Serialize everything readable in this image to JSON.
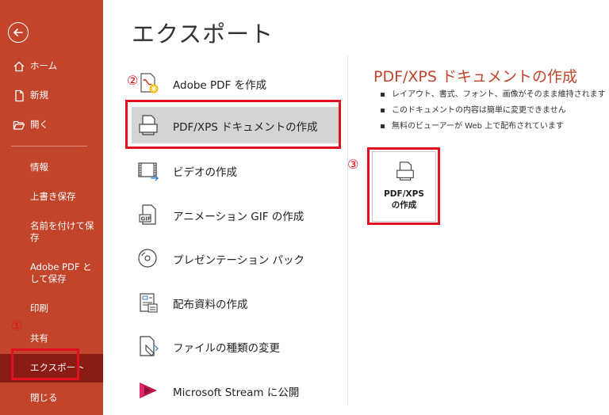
{
  "sidebar": {
    "back_label": "",
    "items": [
      {
        "label": "ホーム",
        "icon": "home-icon"
      },
      {
        "label": "新規",
        "icon": "new-file-icon"
      },
      {
        "label": "開く",
        "icon": "folder-open-icon"
      },
      {
        "label": "情報"
      },
      {
        "label": "上書き保存"
      },
      {
        "label": "名前を付けて保存"
      },
      {
        "label": "Adobe PDF として保存"
      },
      {
        "label": "印刷"
      },
      {
        "label": "共有"
      },
      {
        "label": "エクスポート"
      },
      {
        "label": "閉じる"
      }
    ],
    "active_item": "エクスポート"
  },
  "main": {
    "title": "エクスポート",
    "options": [
      {
        "label": "Adobe PDF を作成",
        "icon": "adobe-pdf-icon"
      },
      {
        "label": "PDF/XPS ドキュメントの作成",
        "icon": "pdf-document-icon"
      },
      {
        "label": "ビデオの作成",
        "icon": "video-icon"
      },
      {
        "label": "アニメーション GIF の作成",
        "icon": "gif-icon"
      },
      {
        "label": "プレゼンテーション パック",
        "icon": "cd-icon"
      },
      {
        "label": "配布資料の作成",
        "icon": "handout-icon"
      },
      {
        "label": "ファイルの種類の変更",
        "icon": "change-type-icon"
      },
      {
        "label": "Microsoft Stream に公開",
        "icon": "stream-icon"
      }
    ],
    "selected_option": "PDF/XPS ドキュメントの作成"
  },
  "detail": {
    "title": "PDF/XPS ドキュメントの作成",
    "bullets": [
      "レイアウト、書式、フォント、画像がそのまま維持されます",
      "このドキュメントの内容は簡単に変更できません",
      "無料のビューアーが Web 上で配布されています"
    ],
    "button": {
      "line1": "PDF/XPS",
      "line2": "の作成",
      "icon": "pdf-document-icon"
    }
  },
  "annotations": {
    "n1": "①",
    "n2": "②",
    "n3": "③"
  },
  "colors": {
    "sidebar_bg": "#c2452b",
    "sidebar_active": "#8a1c14",
    "accent_title": "#c2452b",
    "annotation_red": "#e0101e",
    "selected_option_bg": "#d4d4d4"
  }
}
